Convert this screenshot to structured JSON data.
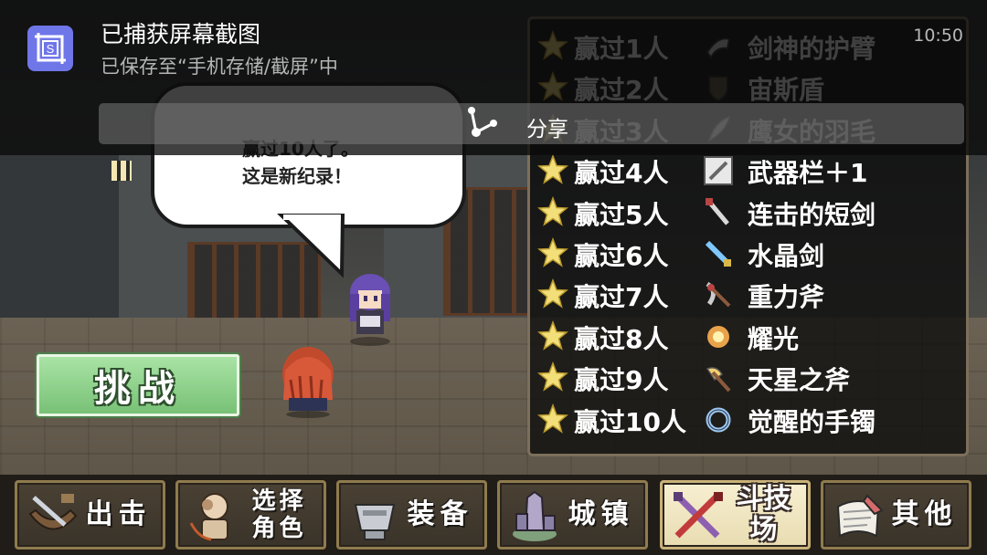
{
  "game": {
    "speech_line1": "赢过10人了。",
    "speech_line2": "这是新纪录！",
    "challenge_label": "挑战",
    "rewards": [
      {
        "win": "赢过1人",
        "item": "剑神的护臂",
        "icon": "armguard-icon"
      },
      {
        "win": "赢过2人",
        "item": "宙斯盾",
        "icon": "shield-icon"
      },
      {
        "win": "赢过3人",
        "item": "鹰女的羽毛",
        "icon": "feather-icon"
      },
      {
        "win": "赢过4人",
        "item": "武器栏＋1",
        "icon": "weapon-slot-icon"
      },
      {
        "win": "赢过5人",
        "item": "连击的短剑",
        "icon": "dagger-icon"
      },
      {
        "win": "赢过6人",
        "item": "水晶剑",
        "icon": "crystal-sword-icon"
      },
      {
        "win": "赢过7人",
        "item": "重力斧",
        "icon": "gravity-axe-icon"
      },
      {
        "win": "赢过8人",
        "item": "耀光",
        "icon": "radiance-icon"
      },
      {
        "win": "赢过9人",
        "item": "天星之斧",
        "icon": "star-axe-icon"
      },
      {
        "win": "赢过10人",
        "item": "觉醒的手镯",
        "icon": "bracelet-icon"
      }
    ],
    "menu": [
      {
        "label": "出击",
        "icon": "sortie-icon"
      },
      {
        "label": "选择角色",
        "line1": "选择",
        "line2": "角色",
        "icon": "character-select-icon"
      },
      {
        "label": "装备",
        "icon": "equipment-icon"
      },
      {
        "label": "城镇",
        "icon": "town-icon"
      },
      {
        "label": "斗技场",
        "icon": "arena-icon",
        "active": true
      },
      {
        "label": "其他",
        "icon": "other-icon"
      }
    ]
  },
  "notification": {
    "title": "已捕获屏幕截图",
    "subtitle": "已保存至“手机存储/截屏”中",
    "time": "10:50",
    "share_label": "分享",
    "icon": "screenshot-icon",
    "accent": "#6f76e8"
  }
}
